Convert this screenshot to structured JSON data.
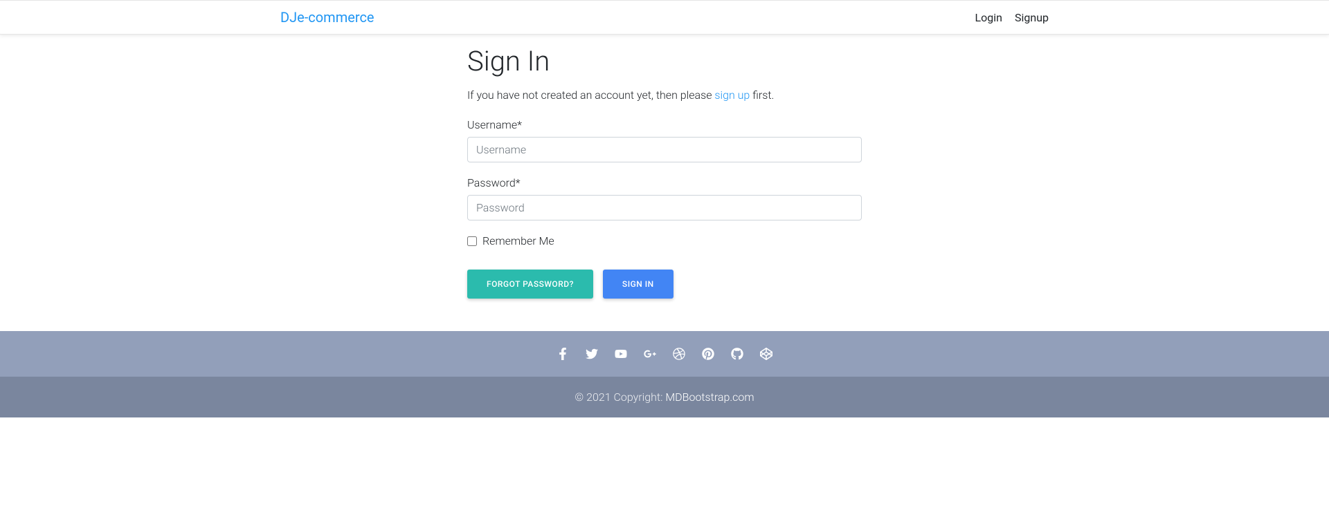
{
  "navbar": {
    "brand": "DJe-commerce",
    "links": {
      "login": "Login",
      "signup": "Signup"
    }
  },
  "signin": {
    "heading": "Sign In",
    "subtitle_prefix": "If you have not created an account yet, then please ",
    "subtitle_link": "sign up",
    "subtitle_suffix": " first.",
    "username_label": "Username*",
    "username_placeholder": "Username",
    "password_label": "Password*",
    "password_placeholder": "Password",
    "remember_label": "Remember Me",
    "forgot_button": "Forgot Password?",
    "signin_button": "Sign In"
  },
  "footer": {
    "copyright_prefix": "© 2021 Copyright: ",
    "copyright_link": "MDBootstrap.com"
  }
}
